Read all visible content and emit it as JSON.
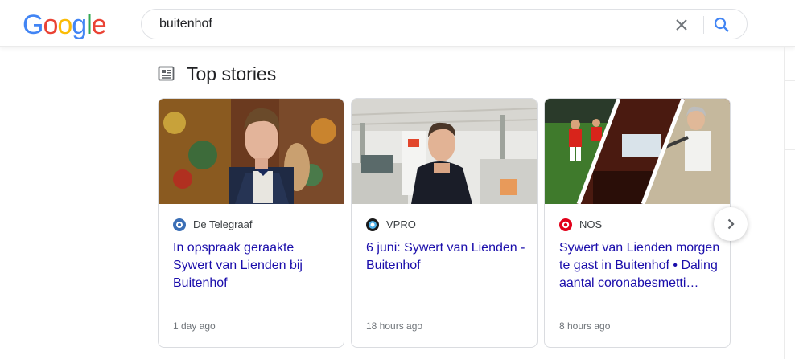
{
  "header": {
    "logo": {
      "letters": [
        "G",
        "o",
        "o",
        "g",
        "l",
        "e"
      ],
      "colors": [
        "#4285f4",
        "#ea4335",
        "#fbbc05",
        "#4285f4",
        "#34a853",
        "#ea4335"
      ]
    },
    "search": {
      "value": "buitenhof",
      "placeholder": ""
    },
    "icons": {
      "clear": "close-icon",
      "search": "search-icon"
    }
  },
  "section": {
    "title": "Top stories",
    "icon": "newspaper-icon"
  },
  "stories": [
    {
      "source": "De Telegraaf",
      "headline": "In opspraak geraakte Sywert van Lienden bij Buitenhof",
      "time": "1 day ago",
      "source_color": "#3b6fb6"
    },
    {
      "source": "VPRO",
      "headline": "6 juni: Sywert van Lienden - Buitenhof",
      "time": "18 hours ago",
      "source_color": "#1a1a1a"
    },
    {
      "source": "NOS",
      "headline": "Sywert van Lienden morgen te gast in Buitenhof • Daling aantal coronabesmetti…",
      "time": "8 hours ago",
      "source_color": "#e2001a"
    }
  ],
  "colors": {
    "link": "#1a0dab",
    "meta": "#70757a",
    "accent": "#4285f4"
  }
}
